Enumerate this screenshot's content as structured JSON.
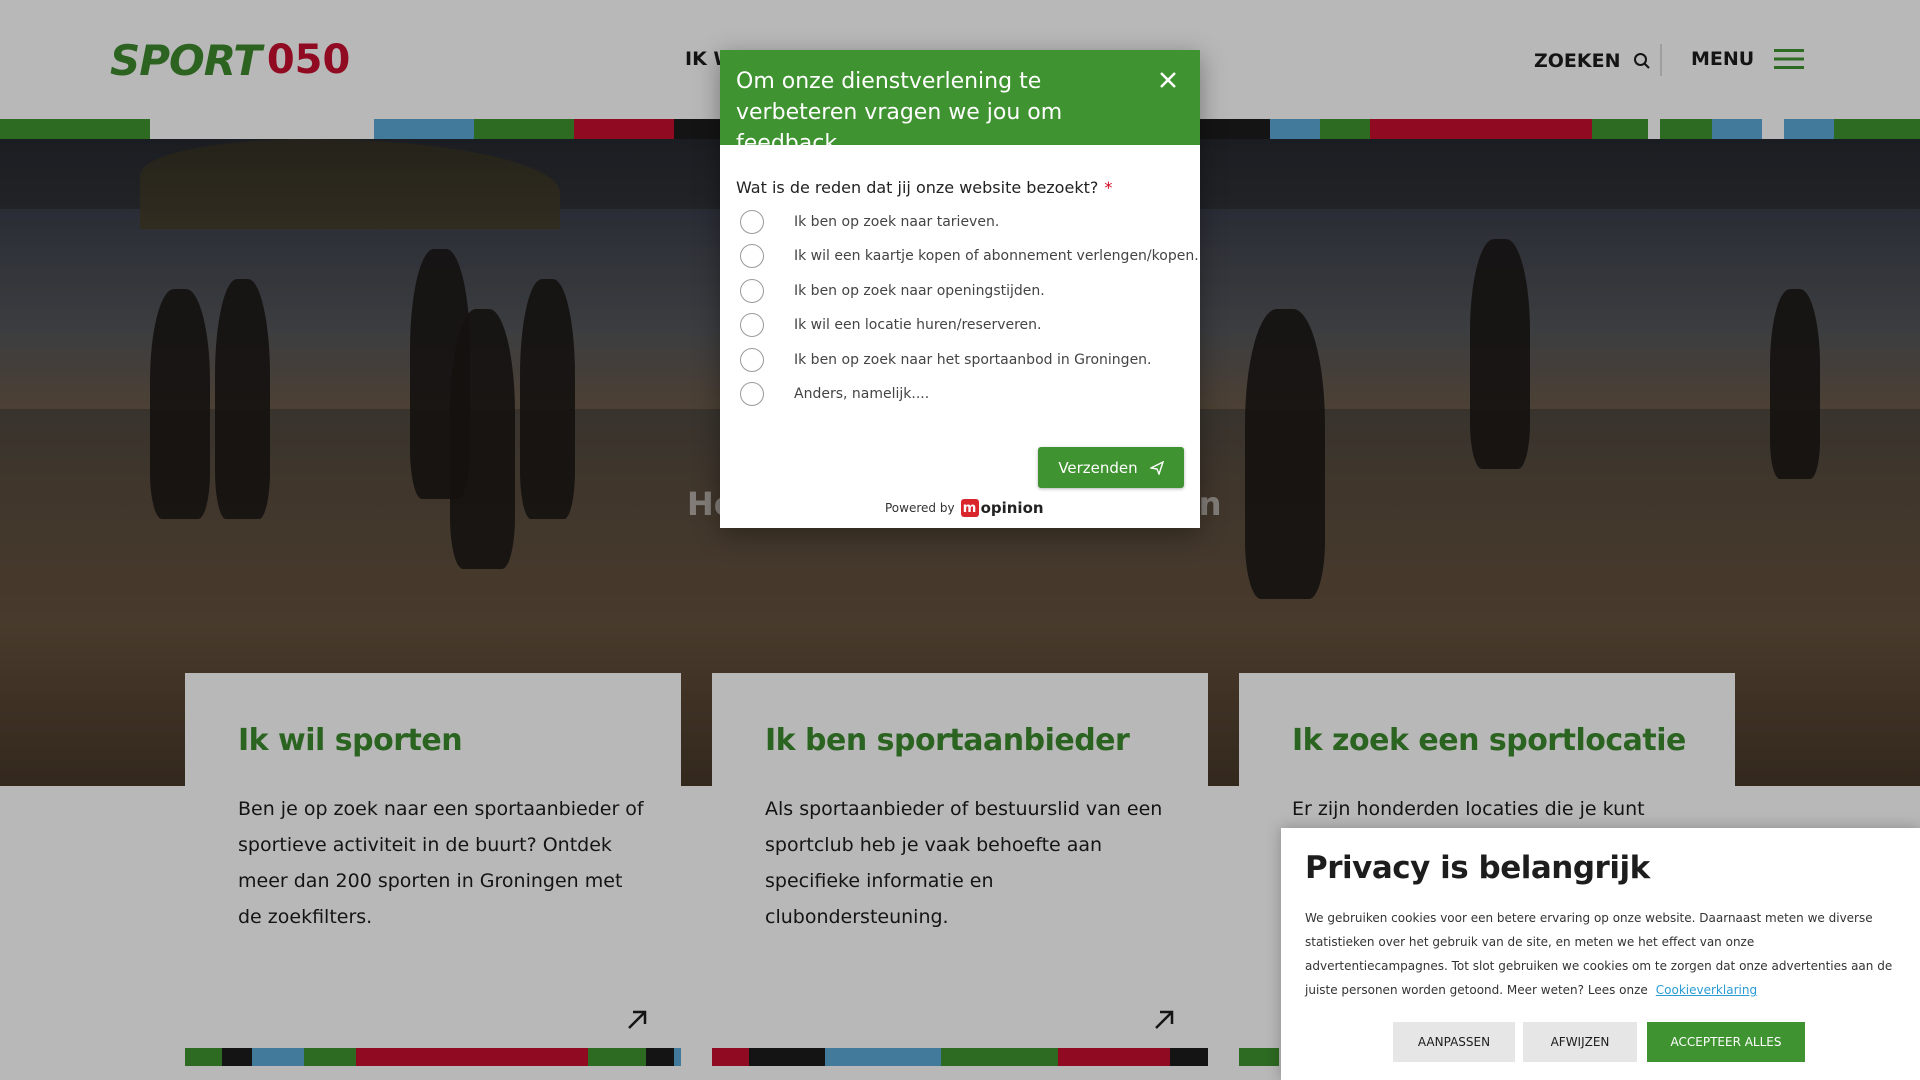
{
  "header": {
    "logo_text_sport": "SPORT",
    "logo_text_num": "050",
    "nav_partial": "IK W",
    "search_label": "ZOEKEN",
    "menu_label": "MENU"
  },
  "colors": {
    "green": "#3f9330",
    "blue": "#5aaad6",
    "red": "#c8102e",
    "black": "#1d1d1d"
  },
  "hero": {
    "title_start": "Hé",
    "title_end": "en"
  },
  "cards": [
    {
      "title": "Ik wil sporten",
      "text": "Ben je op zoek naar een sportaanbieder of sportieve activiteit in de buurt? Ontdek meer dan 200 sporten in Groningen met de zoekfilters."
    },
    {
      "title": "Ik ben sportaanbieder",
      "text": "Als sportaanbieder of bestuurslid van een sportclub heb je vaak behoefte aan specifieke informatie en clubondersteuning."
    },
    {
      "title": "Ik zoek een sportlocatie",
      "text": "Er zijn honderden locaties die je kunt huren"
    }
  ],
  "feedback_modal": {
    "title": "Om onze dienstverlening te verbeteren vragen we jou om feedback",
    "question": "Wat is de reden dat jij onze website bezoekt?",
    "required_mark": "*",
    "options": [
      "Ik ben op zoek naar tarieven.",
      "Ik wil een kaartje kopen of abonnement verlengen/kopen.",
      "Ik ben op zoek naar openingstijden.",
      "Ik wil een locatie huren/reserveren.",
      "Ik ben op zoek naar het sportaanbod in Groningen.",
      "Anders, namelijk...."
    ],
    "send_label": "Verzenden",
    "powered_by": "Powered by",
    "brand_mark": "m",
    "brand": "opinion"
  },
  "cookie_banner": {
    "title": "Privacy is belangrijk",
    "text": "We gebruiken cookies voor een betere ervaring op onze website. Daarnaast meten we diverse statistieken over het gebruik van de site, en meten we het effect van onze advertentiecampagnes. Tot slot gebruiken we cookies om te zorgen dat onze advertenties aan de juiste personen worden getoond. Meer weten? Lees onze",
    "link": "Cookieverklaring",
    "btn_customize": "AANPASSEN",
    "btn_reject": "AFWIJZEN",
    "btn_accept": "ACCEPTEER ALLES"
  }
}
